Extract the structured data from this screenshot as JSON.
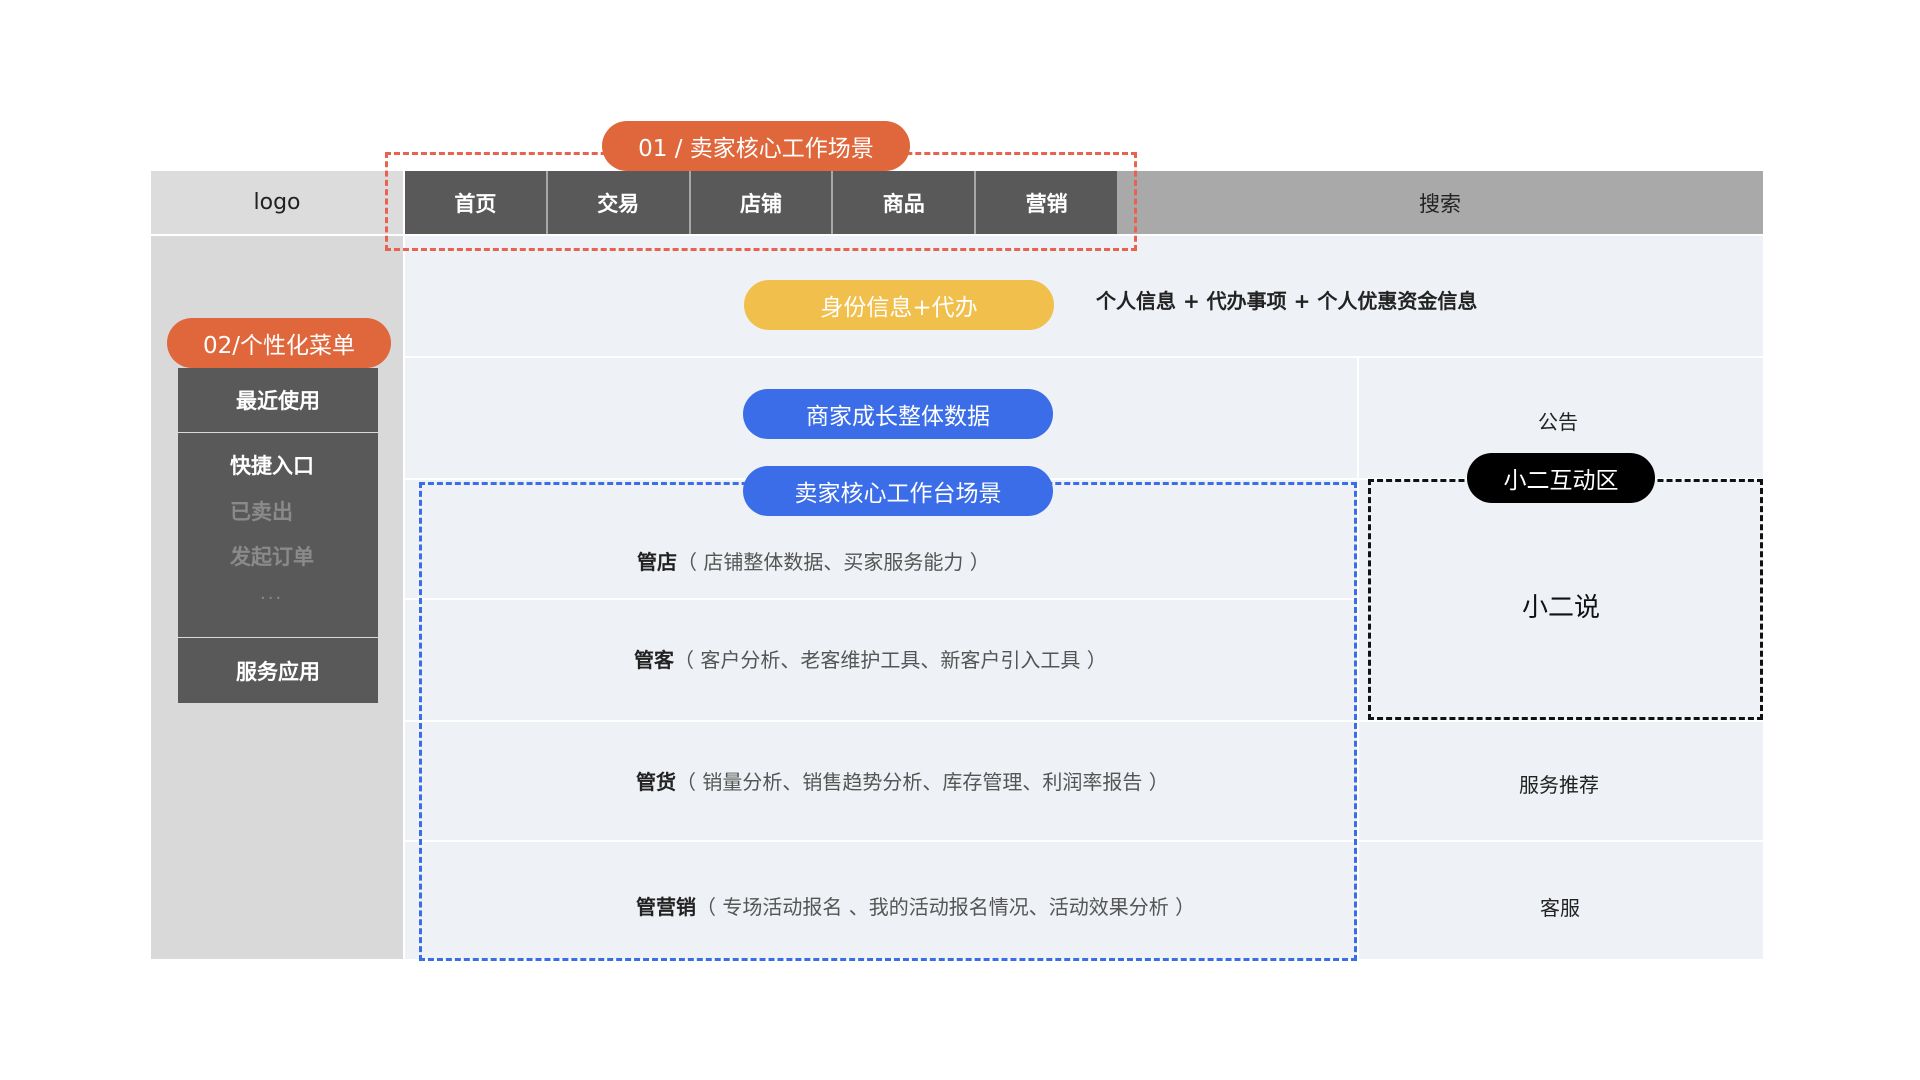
{
  "header": {
    "logo": "logo",
    "nav_tabs": [
      "首页",
      "交易",
      "店铺",
      "商品",
      "营销"
    ],
    "search": "搜索"
  },
  "callouts": {
    "scene": "01 / 卖家核心工作场景",
    "menu": "02/个性化菜单",
    "identity": "身份信息+代办",
    "growth": "商家成长整体数据",
    "workbench": "卖家核心工作台场景",
    "interact": "小二互动区"
  },
  "sidebar": {
    "recent": "最近使用",
    "quick_title": "快捷入口",
    "quick_items": [
      "已卖出",
      "发起订单",
      "..."
    ],
    "service_apps": "服务应用"
  },
  "main": {
    "identity_desc": "个人信息 + 代办事项 + 个人优惠资金信息",
    "rows": [
      {
        "title": "管店",
        "detail": "（ 店铺整体数据、买家服务能力 ）"
      },
      {
        "title": "管客",
        "detail": "（ 客户分析、老客维护工具、新客户引入工具 ）"
      },
      {
        "title": "管货",
        "detail": "（ 销量分析、销售趋势分析、库存管理、利润率报告 ）"
      },
      {
        "title": "管营销",
        "detail": "（ 专场活动报名 、我的活动报名情况、活动效果分析 ）"
      }
    ]
  },
  "right": {
    "notice": "公告",
    "xiaoer_says": "小二说",
    "service_recommend": "服务推荐",
    "customer_service": "客服"
  },
  "colors": {
    "orange": "#e0663b",
    "yellow": "#f0bf4c",
    "blue": "#3b6de8",
    "dark_gray": "#595959",
    "panel": "#eef1f5"
  }
}
